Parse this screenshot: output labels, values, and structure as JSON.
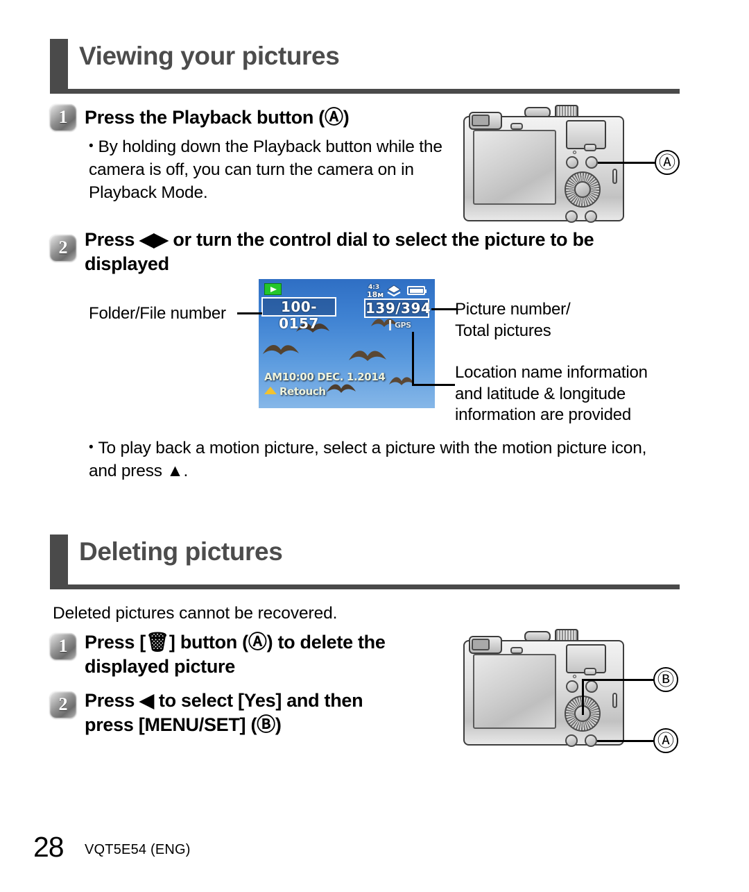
{
  "page": {
    "number": "28",
    "doc_code": "VQT5E54 (ENG)"
  },
  "sections": [
    {
      "id": "viewing",
      "title": "Viewing your pictures",
      "steps": [
        {
          "badge": "1",
          "heading": "Press the Playback button (Ⓐ)",
          "bullets": [
            "By holding down the Playback button while the camera is off, you can turn the camera on in Playback Mode."
          ]
        },
        {
          "badge": "2",
          "heading": "Press ◀▶ or turn the control dial to select the picture to be displayed",
          "bullets": [
            "To play back a motion picture, select a picture with the motion picture icon, and press ▲."
          ]
        }
      ],
      "callouts": {
        "left_label": "Folder/File number",
        "right_label_1_line1": "Picture number/",
        "right_label_1_line2": "Total pictures",
        "right_label_2_line1": "Location name information",
        "right_label_2_line2": "and latitude & longitude",
        "right_label_2_line3": "information are provided"
      },
      "camera_callout_a": "Ⓐ"
    },
    {
      "id": "deleting",
      "title": "Deleting pictures",
      "intro": "Deleted pictures cannot be recovered.",
      "steps": [
        {
          "badge": "1",
          "heading_line1": "Press [🗑] button (Ⓐ) to delete the",
          "heading_line2": "displayed picture"
        },
        {
          "badge": "2",
          "heading_line1": "Press ◀ to select [Yes] and then",
          "heading_line2": "press [MENU/SET] (Ⓑ)"
        }
      ],
      "camera_callout_a": "Ⓐ",
      "camera_callout_b": "Ⓑ"
    }
  ],
  "lcd_preview": {
    "playback_mode_icon": "playback-icon",
    "folder_file_number": "100-0157",
    "picture_counter": "139/394",
    "resolution": "18м",
    "quality_icon": "quality-fine-icon",
    "battery_icon": "battery-full-icon",
    "gps_label": "GPS",
    "datestamp": "AM10:00 DEC. 1.2014",
    "retouch_label": "Retouch",
    "scene_description": "birds flying in blue sky"
  },
  "colors": {
    "header_bar": "#4a4a4a",
    "header_title": "#4c4c4c",
    "lcd_sky": "#3f82d2",
    "playback_icon_green": "#24c72b",
    "retouch_triangle": "#f2c230",
    "text": "#000000"
  }
}
